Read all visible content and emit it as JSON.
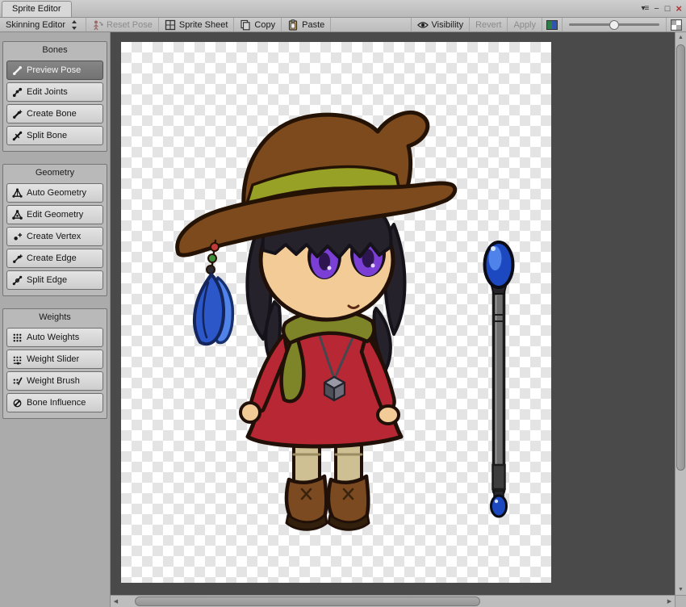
{
  "window": {
    "tab_title": "Sprite Editor",
    "controls": {
      "menu_arrow_glyph": "▾",
      "menu_glyph": "≡",
      "minimize_glyph": "−",
      "maximize_glyph": "□",
      "close_glyph": "×"
    }
  },
  "toolbar": {
    "mode_dropdown": {
      "label": "Skinning Editor",
      "icon": "updown-arrows-icon"
    },
    "reset_pose": {
      "label": "Reset Pose",
      "icon": "reset-pose-icon",
      "enabled": false
    },
    "sprite_sheet": {
      "label": "Sprite Sheet",
      "icon": "sprite-sheet-icon",
      "enabled": true
    },
    "copy": {
      "label": "Copy",
      "icon": "copy-icon",
      "enabled": true
    },
    "paste": {
      "label": "Paste",
      "icon": "paste-icon",
      "enabled": true
    },
    "visibility": {
      "label": "Visibility",
      "icon": "eye-icon",
      "enabled": true
    },
    "revert": {
      "label": "Revert",
      "enabled": false
    },
    "apply": {
      "label": "Apply",
      "enabled": false
    },
    "rgb_swatch_icon": "rgb-swatch-icon",
    "zoom_slider": {
      "position_pct": 50
    },
    "alpha_checker_icon": "alpha-checker-icon"
  },
  "sidebar": {
    "panels": [
      {
        "title": "Bones",
        "items": [
          {
            "label": "Preview Pose",
            "icon": "preview-pose-icon",
            "selected": true
          },
          {
            "label": "Edit Joints",
            "icon": "edit-joints-icon",
            "selected": false
          },
          {
            "label": "Create Bone",
            "icon": "create-bone-icon",
            "selected": false
          },
          {
            "label": "Split Bone",
            "icon": "split-bone-icon",
            "selected": false
          }
        ]
      },
      {
        "title": "Geometry",
        "items": [
          {
            "label": "Auto Geometry",
            "icon": "auto-geometry-icon",
            "selected": false
          },
          {
            "label": "Edit Geometry",
            "icon": "edit-geometry-icon",
            "selected": false
          },
          {
            "label": "Create Vertex",
            "icon": "create-vertex-icon",
            "selected": false
          },
          {
            "label": "Create Edge",
            "icon": "create-edge-icon",
            "selected": false
          },
          {
            "label": "Split Edge",
            "icon": "split-edge-icon",
            "selected": false
          }
        ]
      },
      {
        "title": "Weights",
        "items": [
          {
            "label": "Auto Weights",
            "icon": "auto-weights-icon",
            "selected": false
          },
          {
            "label": "Weight Slider",
            "icon": "weight-slider-icon",
            "selected": false
          },
          {
            "label": "Weight Brush",
            "icon": "weight-brush-icon",
            "selected": false
          },
          {
            "label": "Bone Influence",
            "icon": "bone-influence-icon",
            "selected": false
          }
        ]
      }
    ]
  },
  "canvas": {
    "content_description": "Chibi witch character sprite (brown hat, purple eyes, red dress, green scarf, brown boots, blue feather) with a blue-gem staff, on transparent checkerboard",
    "background_color": "#4a4a4a",
    "checker_colors": [
      "#ffffff",
      "#e4e4e4"
    ]
  },
  "colors": {
    "ui_background": "#c4c4c4",
    "sidebar_background": "#ababab",
    "selected_tool_background": "#7c7c7c",
    "close_button_red": "#b03434"
  }
}
